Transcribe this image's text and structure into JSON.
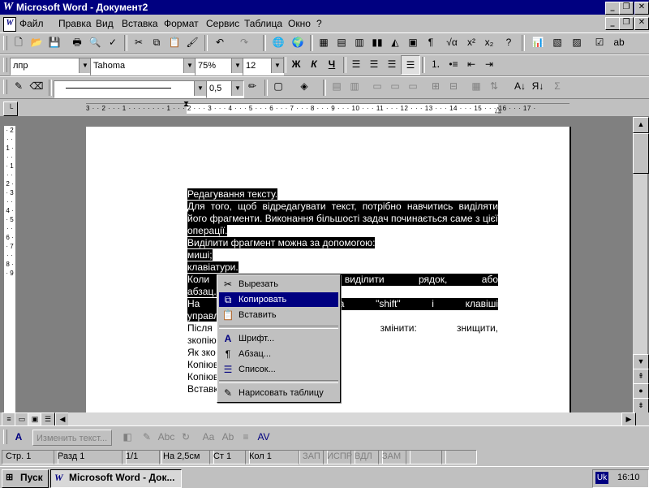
{
  "window": {
    "title": "Microsoft Word - Документ2",
    "controls": [
      "_",
      "❐",
      "✕"
    ]
  },
  "menubar": {
    "items": [
      "Файл",
      "Правка",
      "Вид",
      "Вставка",
      "Формат",
      "Сервис",
      "Таблица",
      "Окно",
      "?"
    ],
    "doc_controls": [
      "_",
      "❐",
      "✕"
    ]
  },
  "formatting": {
    "style": "лпр",
    "font": "Tahoma",
    "zoom": "75%",
    "size": "12",
    "bold": "Ж",
    "italic": "К",
    "underline": "Ч"
  },
  "tables_toolbar": {
    "line_weight": "0,5"
  },
  "ruler": {
    "scale": "3 · · 2 · · · 1 · · · · · · · · 1 · · · 2 · · · 3 · · · 4 · · · 5 · · · 6 · · · 7 · · · 8 · · · 9 · · · 10 · · · 11 · · · 12 · · · 13 · · · 14 · · · 15 · · · 16 · · · 17 ·",
    "vertical_scale": "· 2 · · 1 · · · · 1 · · 2 · · 3 · · 4 · · 5 · · 6 · · 7 · · 8 · · 9"
  },
  "document": {
    "lines": [
      {
        "text": "Редагування тексту. ",
        "selected": true,
        "justify": false
      },
      {
        "text": "Для того, щоб відредагувати текст, потрібно навчитись виділяти",
        "selected": true,
        "justify": true
      },
      {
        "text": "його фрагменти. Виконання більшості задач починається саме з цієї",
        "selected": true,
        "justify": true
      },
      {
        "text": "операції. ",
        "selected": true,
        "justify": false
      },
      {
        "text": "Виділити фрагмент можна за допомогою: ",
        "selected": true,
        "justify": false
      },
      {
        "text": "миші;",
        "selected": true,
        "justify": false
      },
      {
        "text": "клавіатури.",
        "selected": true,
        "justify": false
      },
      {
        "text": "Коли                                              , можна виділити рядок, або",
        "selected": true,
        "justify": true
      },
      {
        "text": "абзац.",
        "selected": true,
        "justify": false
      },
      {
        "text": "На   к                              ся   клавіша   \"shift\"   і   клавіші",
        "selected": true,
        "justify": true
      },
      {
        "text": "управл",
        "selected": true,
        "justify": false
      },
      {
        "text": "Після                                  ксту   можна   змінити:   знищити,",
        "selected": false,
        "justify": true
      },
      {
        "text": "зкопіює                                   і т.д.",
        "selected": false,
        "justify": false
      },
      {
        "text": "Як зко",
        "selected": false,
        "justify": false
      },
      {
        "text": "Копіюв                                оцесів:",
        "selected": false,
        "justify": false
      },
      {
        "text": "Копіюв",
        "selected": false,
        "justify": false
      },
      {
        "text": "Вставк",
        "selected": false,
        "justify": false
      }
    ]
  },
  "context_menu": {
    "items": [
      {
        "label": "Вырезать",
        "icon": "scissors-icon",
        "glyph": "✂",
        "highlight": false
      },
      {
        "label": "Копировать",
        "icon": "copy-icon",
        "glyph": "⧉",
        "highlight": true
      },
      {
        "label": "Вставить",
        "icon": "paste-icon",
        "glyph": "📋",
        "highlight": false
      },
      {
        "label": "Шрифт...",
        "icon": "font-icon",
        "glyph": "A",
        "highlight": false
      },
      {
        "label": "Абзац...",
        "icon": "paragraph-icon",
        "glyph": "¶",
        "highlight": false
      },
      {
        "label": "Список...",
        "icon": "list-icon",
        "glyph": "☰",
        "highlight": false
      },
      {
        "label": "Нарисовать таблицу",
        "icon": "pencil-icon",
        "glyph": "✎",
        "highlight": false
      }
    ]
  },
  "drawing_toolbar": {
    "edit_text": "Изменить текст..."
  },
  "statusbar": {
    "page": "Стр. 1",
    "section": "Разд 1",
    "pages": "1/1",
    "position": "На 2,5см",
    "line": "Ст 1",
    "column": "Кол 1",
    "rec": "ЗАП",
    "trk": "ИСПР",
    "ext": "ВДЛ",
    "ovr": "ЗАМ"
  },
  "taskbar": {
    "start": "Пуск",
    "task": "Microsoft Word - Док...",
    "lang": "Uk",
    "time": "16:10"
  },
  "colors": {
    "titlebar": "#000080",
    "face": "#c0c0c0",
    "highlight": "#000080",
    "selection": "#000000"
  }
}
